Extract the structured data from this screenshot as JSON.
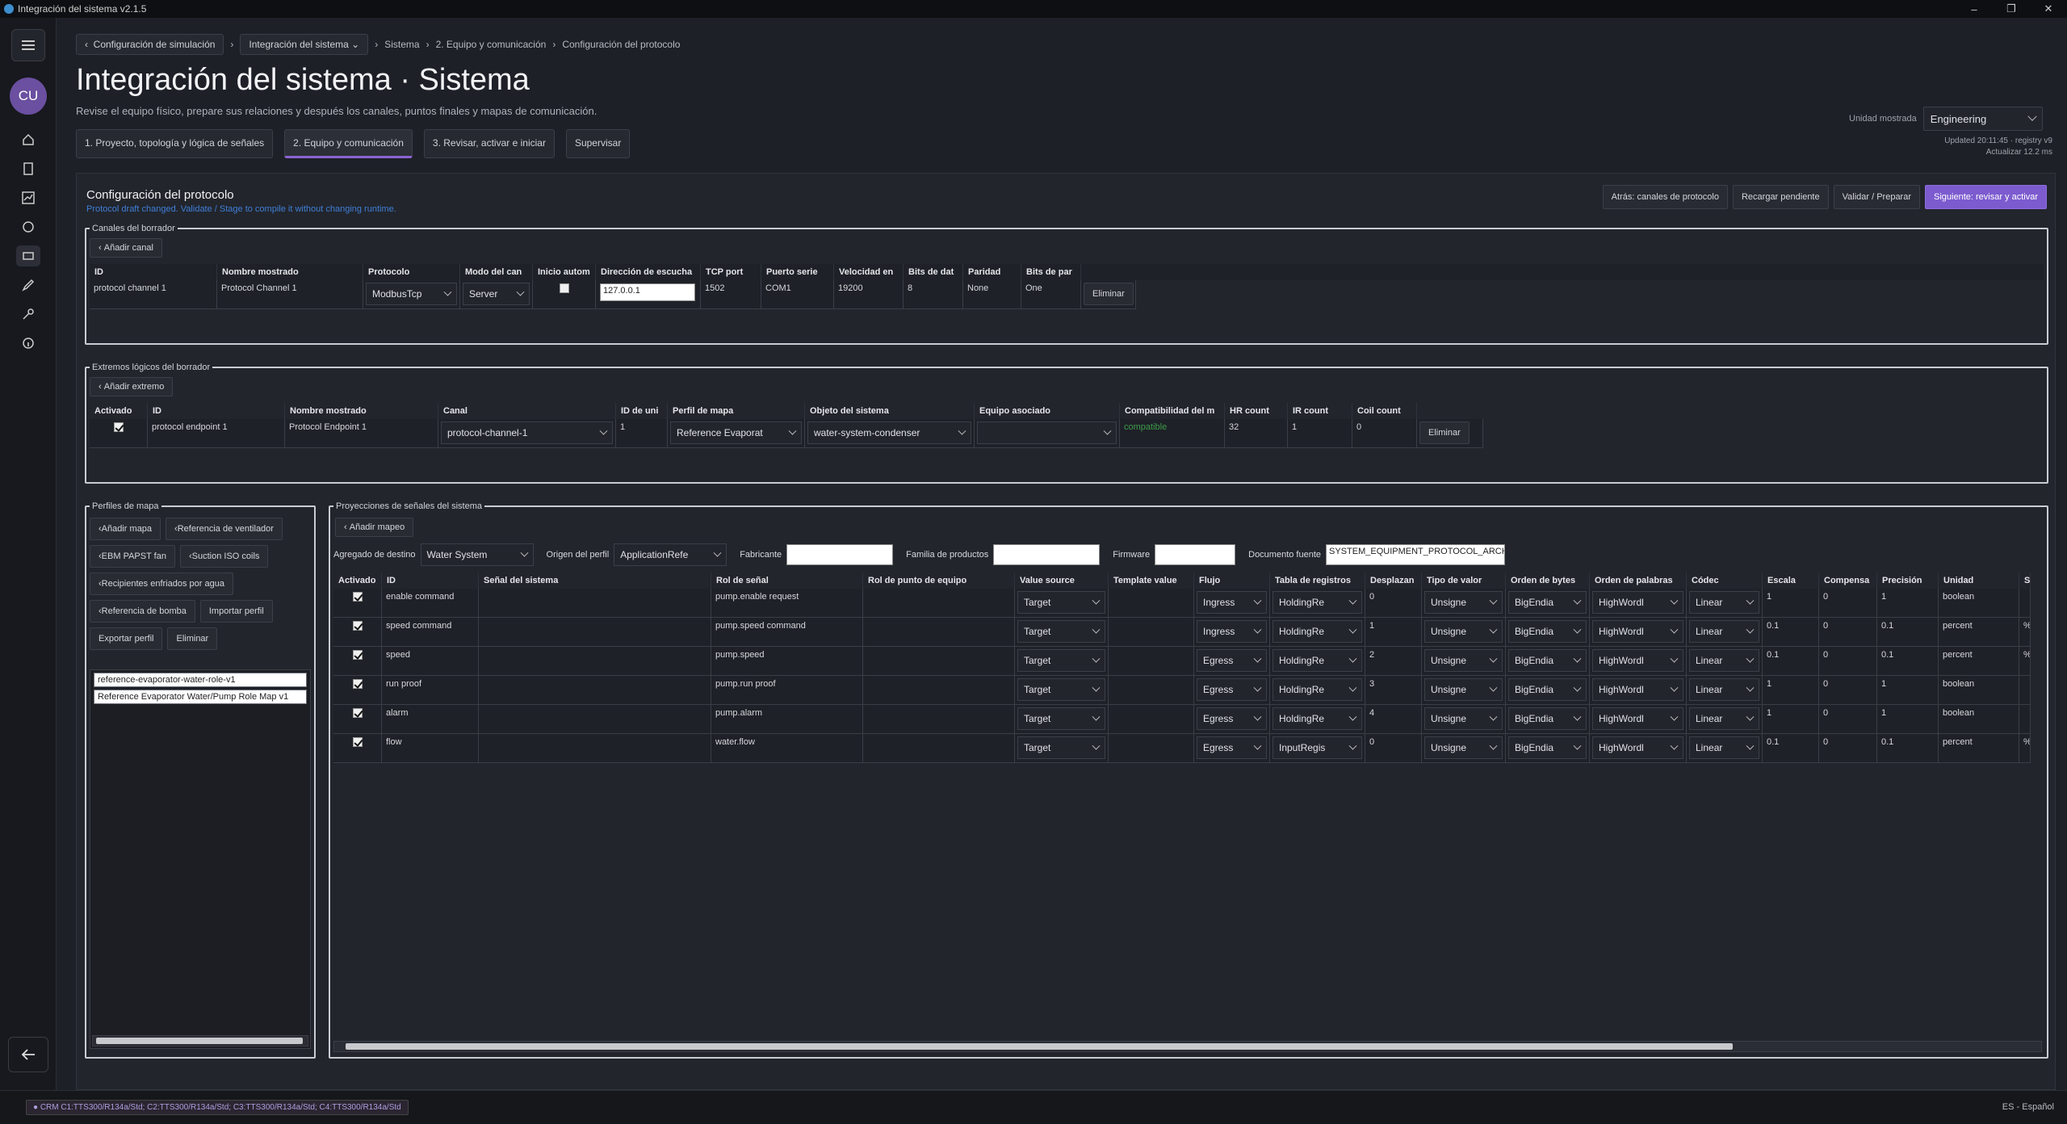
{
  "window": {
    "title": "Integración del sistema v2.1.5"
  },
  "sidebar": {
    "avatar": "CU"
  },
  "breadcrumb": {
    "back": "Configuración de simulación",
    "current": "Integración del sistema",
    "path": [
      "Sistema",
      "2. Equipo y comunicación",
      "Configuración del protocolo"
    ]
  },
  "page": {
    "title": "Integración del sistema · Sistema",
    "subtitle": "Revise el equipo físico, prepare sus relaciones y después los canales, puntos finales y mapas de comunicación."
  },
  "steps": [
    "1. Proyecto, topología y lógica de señales",
    "2. Equipo y comunicación",
    "3. Revisar, activar e iniciar",
    "Supervisar"
  ],
  "unit": {
    "label": "Unidad mostrada",
    "value": "Engineering"
  },
  "updated": {
    "line1": "Updated 20:11:45 · registry v9",
    "line2": "Actualizar 12.2 ms"
  },
  "protocol": {
    "title": "Configuración del protocolo",
    "hint": "Protocol draft changed. Validate / Stage to compile it without changing runtime.",
    "actions": {
      "back": "Atrás: canales de protocolo",
      "reload": "Recargar pendiente",
      "validate": "Validar / Preparar",
      "next": "Siguiente: revisar y activar"
    }
  },
  "channels": {
    "legend": "Canales del borrador",
    "add": "Añadir canal",
    "headers": [
      "ID",
      "Nombre mostrado",
      "Protocolo",
      "Modo del can",
      "Inicio autom",
      "Dirección de escucha",
      "TCP port",
      "Puerto serie",
      "Velocidad en",
      "Bits de dat",
      "Paridad",
      "Bits de par"
    ],
    "row": {
      "id": "protocol channel 1",
      "name": "Protocol Channel 1",
      "protocol": "ModbusTcp",
      "mode": "Server",
      "listen": "127.0.0.1",
      "port": "1502",
      "serial": "COM1",
      "baud": "19200",
      "databits": "8",
      "parity": "None",
      "stopbits": "One",
      "delete": "Eliminar"
    }
  },
  "endpoints": {
    "legend": "Extremos lógicos del borrador",
    "add": "Añadir extremo",
    "headers": [
      "Activado",
      "ID",
      "Nombre mostrado",
      "Canal",
      "ID de uni",
      "Perfil de mapa",
      "Objeto del sistema",
      "Equipo asociado",
      "Compatibilidad del m",
      "HR count",
      "IR count",
      "Coil count"
    ],
    "row": {
      "id": "protocol endpoint 1",
      "name": "Protocol Endpoint 1",
      "channel": "protocol-channel-1",
      "unit": "1",
      "profile": "Reference Evaporat",
      "object": "water-system-condenser",
      "equipment": "",
      "compat": "compatible",
      "hr": "32",
      "ir": "1",
      "coil": "0",
      "delete": "Eliminar"
    }
  },
  "profiles": {
    "legend": "Perfiles de mapa",
    "buttons": [
      "Añadir mapa",
      "Referencia de ventilador",
      "EBM PAPST fan",
      "Suction ISO coils",
      "Recipientes enfriados por agua",
      "Referencia de bomba",
      "Importar perfil",
      "Exportar perfil",
      "Eliminar"
    ],
    "items": [
      "reference-evaporator-water-role-v1",
      "Reference Evaporator Water/Pump Role Map v1"
    ]
  },
  "projections": {
    "legend": "Proyecciones de señales del sistema",
    "add": "Añadir mapeo",
    "filters": {
      "aggregate_label": "Agregado de destino",
      "aggregate": "Water System",
      "origin_label": "Origen del perfil",
      "origin": "ApplicationRefe",
      "maker_label": "Fabricante",
      "family_label": "Familia de productos",
      "firmware_label": "Firmware",
      "source_label": "Documento fuente",
      "source": "SYSTEM_EQUIPMENT_PROTOCOL_ARCHI"
    },
    "headers": [
      "Activado",
      "ID",
      "Señal del sistema",
      "Rol de señal",
      "Rol de punto de equipo",
      "Value source",
      "Template value",
      "Flujo",
      "Tabla de registros",
      "Desplazan",
      "Tipo de valor",
      "Orden de bytes",
      "Orden de palabras",
      "Códec",
      "Escala",
      "Compensa",
      "Precisión",
      "Unidad",
      "S"
    ],
    "rows": [
      {
        "id": "enable command",
        "role": "pump.enable request",
        "src": "Target",
        "flow": "Ingress",
        "table": "HoldingRe",
        "off": "0",
        "type": "Unsigne",
        "bytes": "BigEndia",
        "words": "HighWordl",
        "codec": "Linear",
        "scale": "1",
        "comp": "0",
        "prec": "1",
        "unit": "boolean",
        "s": ""
      },
      {
        "id": "speed command",
        "role": "pump.speed command",
        "src": "Target",
        "flow": "Ingress",
        "table": "HoldingRe",
        "off": "1",
        "type": "Unsigne",
        "bytes": "BigEndia",
        "words": "HighWordl",
        "codec": "Linear",
        "scale": "0.1",
        "comp": "0",
        "prec": "0.1",
        "unit": "percent",
        "s": "%"
      },
      {
        "id": "speed",
        "role": "pump.speed",
        "src": "Target",
        "flow": "Egress",
        "table": "HoldingRe",
        "off": "2",
        "type": "Unsigne",
        "bytes": "BigEndia",
        "words": "HighWordl",
        "codec": "Linear",
        "scale": "0.1",
        "comp": "0",
        "prec": "0.1",
        "unit": "percent",
        "s": "%"
      },
      {
        "id": "run proof",
        "role": "pump.run proof",
        "src": "Target",
        "flow": "Egress",
        "table": "HoldingRe",
        "off": "3",
        "type": "Unsigne",
        "bytes": "BigEndia",
        "words": "HighWordl",
        "codec": "Linear",
        "scale": "1",
        "comp": "0",
        "prec": "1",
        "unit": "boolean",
        "s": ""
      },
      {
        "id": "alarm",
        "role": "pump.alarm",
        "src": "Target",
        "flow": "Egress",
        "table": "HoldingRe",
        "off": "4",
        "type": "Unsigne",
        "bytes": "BigEndia",
        "words": "HighWordl",
        "codec": "Linear",
        "scale": "1",
        "comp": "0",
        "prec": "1",
        "unit": "boolean",
        "s": ""
      },
      {
        "id": "flow",
        "role": "water.flow",
        "src": "Target",
        "flow": "Egress",
        "table": "InputRegis",
        "off": "0",
        "type": "Unsigne",
        "bytes": "BigEndia",
        "words": "HighWordl",
        "codec": "Linear",
        "scale": "0.1",
        "comp": "0",
        "prec": "0.1",
        "unit": "percent",
        "s": "%"
      }
    ]
  },
  "status": {
    "badge": "● CRM C1:TTS300/R134a/Std; C2:TTS300/R134a/Std; C3:TTS300/R134a/Std; C4:TTS300/R134a/Std",
    "lang": "ES - Español"
  }
}
